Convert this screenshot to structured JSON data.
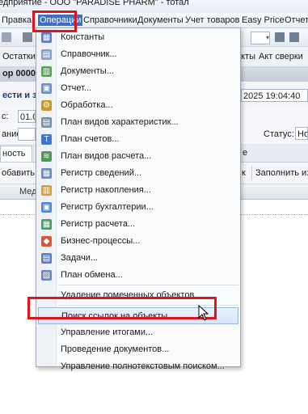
{
  "window": {
    "title": "едприятие - ООО \"PARADISE PHARM\" - тотал"
  },
  "menubar": [
    "Правка",
    "Операции",
    "Справочники",
    "Документы",
    "Учет товаров",
    "Easy Price",
    "Отчеты"
  ],
  "toolbar2": {
    "left": "Остатки",
    "right1": "акты",
    "right2": "Акт сверки"
  },
  "doc": {
    "title": "ор 00000",
    "tab_partial": "ести и за",
    "datetime": "2025 19:04:40",
    "status_label": "Статус:",
    "status_value": "Нов",
    "label_c": "с:",
    "value_c": "01.0",
    "label_name": "ание:"
  },
  "tabs": {
    "first": "ность",
    "right": "е"
  },
  "row_buttons": {
    "add": "обавить",
    "right_a": "к",
    "fill": "Заполнить из С"
  },
  "header": {
    "col": "Мед"
  },
  "menu": {
    "groups": [
      [
        {
          "label": "Константы",
          "icon": "constants-icon",
          "color": "#5b7cc4"
        },
        {
          "label": "Справочник...",
          "icon": "catalog-icon",
          "color": "#8aa0c8"
        },
        {
          "label": "Документы...",
          "icon": "documents-icon",
          "color": "#5aa05a"
        },
        {
          "label": "Отчет...",
          "icon": "report-icon",
          "color": "#6e8ec2"
        },
        {
          "label": "Обработка...",
          "icon": "processing-icon",
          "color": "#c49a2e"
        },
        {
          "label": "План видов характеристик...",
          "icon": "characteristics-plan-icon",
          "color": "#7b8ea8"
        },
        {
          "label": "План счетов...",
          "icon": "accounts-plan-icon",
          "color": "#3f78c8"
        },
        {
          "label": "План видов расчета...",
          "icon": "calculation-plan-icon",
          "color": "#4e9a56"
        },
        {
          "label": "Регистр сведений...",
          "icon": "info-register-icon",
          "color": "#6a88b8"
        },
        {
          "label": "Регистр накопления...",
          "icon": "accumulation-register-icon",
          "color": "#d0a23a"
        },
        {
          "label": "Регистр бухгалтерии...",
          "icon": "accounting-register-icon",
          "color": "#4f86cf"
        },
        {
          "label": "Регистр расчета...",
          "icon": "calc-register-icon",
          "color": "#4a9a64"
        },
        {
          "label": "Бизнес-процессы...",
          "icon": "business-process-icon",
          "color": "#d25a3a"
        },
        {
          "label": "Задачи...",
          "icon": "tasks-icon",
          "color": "#5a7ec4"
        },
        {
          "label": "План обмена...",
          "icon": "exchange-plan-icon",
          "color": "#6f86b0"
        }
      ],
      [
        {
          "label": "Удаление помеченных объектов"
        }
      ],
      [
        {
          "label": "Поиск ссылок на объекты",
          "highlighted": true
        },
        {
          "label": "Управление итогами..."
        },
        {
          "label": "Проведение документов..."
        },
        {
          "label": "Управление полнотекстовым поиском..."
        }
      ]
    ]
  },
  "accent_red": "#e0141c",
  "highlight_blue": "#d5e5fb"
}
